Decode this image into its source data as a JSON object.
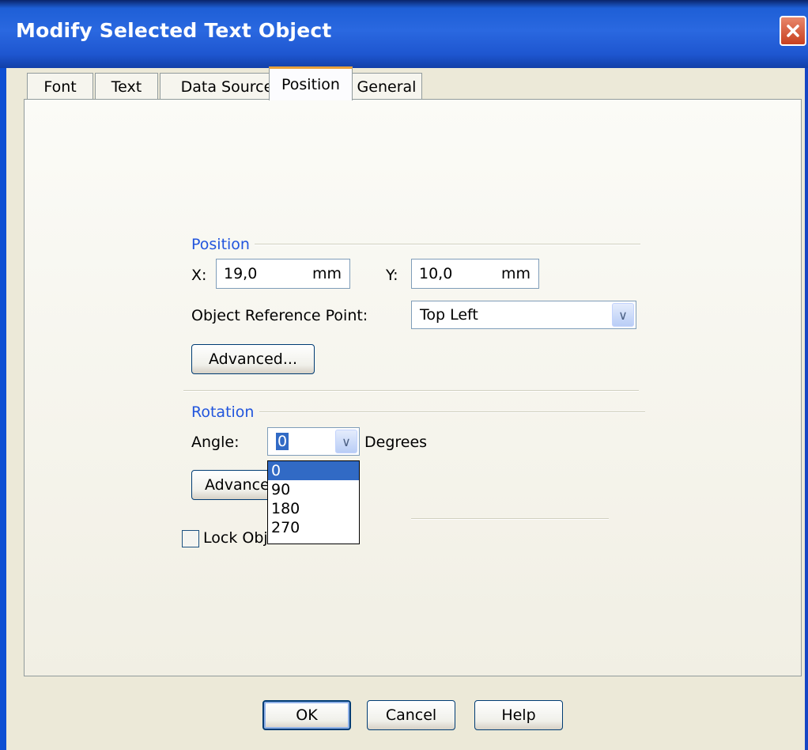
{
  "window": {
    "title": "Modify Selected Text Object"
  },
  "tabs": [
    {
      "label": "Font"
    },
    {
      "label": "Text"
    },
    {
      "label": "Data Source"
    },
    {
      "label": "Position",
      "active": true
    },
    {
      "label": "General"
    }
  ],
  "position_group": {
    "title": "Position",
    "x_label": "X:",
    "x_value": "19,0",
    "x_unit": "mm",
    "y_label": "Y:",
    "y_value": "10,0",
    "y_unit": "mm",
    "ref_point_label": "Object Reference Point:",
    "ref_point_value": "Top Left",
    "advanced_label": "Advanced..."
  },
  "rotation_group": {
    "title": "Rotation",
    "angle_label": "Angle:",
    "angle_value": "0",
    "degrees_label": "Degrees",
    "advanced_label": "Advanced",
    "angle_options": [
      "0",
      "90",
      "180",
      "270"
    ],
    "selected_option": "0"
  },
  "lock_checkbox": {
    "label": "Lock Obj",
    "checked": false
  },
  "footer": {
    "ok_label": "OK",
    "cancel_label": "Cancel",
    "help_label": "Help"
  },
  "colors": {
    "titlebar": "#2a68e0",
    "group_title": "#2255dd",
    "selection": "#316ac5",
    "dialog_bg": "#ece9d8"
  },
  "icons": {
    "close": "close-icon",
    "dropdown": "chevron-down-icon"
  }
}
